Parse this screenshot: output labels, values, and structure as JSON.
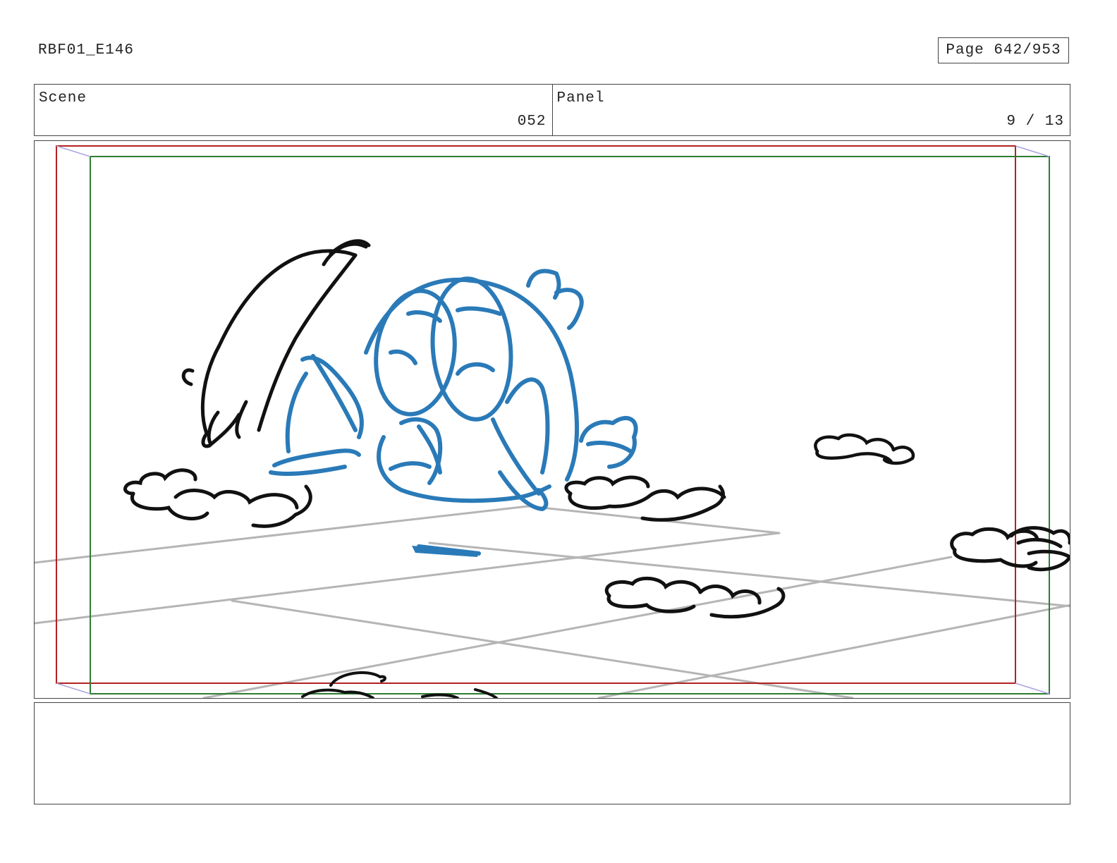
{
  "document": {
    "id": "RBF01_E146",
    "page_label": "Page 642/953"
  },
  "info": {
    "scene_label": "Scene",
    "scene_value": "052",
    "panel_label": "Panel",
    "panel_value": "9 / 13"
  },
  "panel": {
    "safe_frame_color": "#b22222",
    "action_frame_color": "#2e7d32",
    "character_color": "#2a7ab8",
    "ink_color": "#111111",
    "perspective_color": "#b5b5b5"
  },
  "notes": {
    "text": ""
  }
}
